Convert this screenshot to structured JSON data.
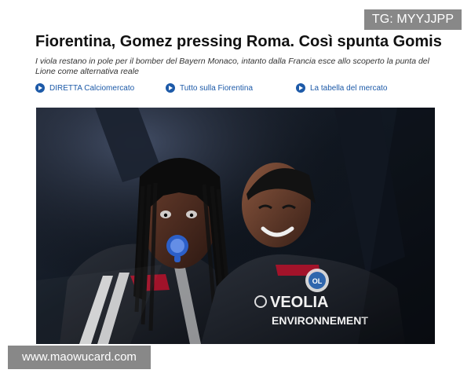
{
  "watermarks": {
    "top_tag": "TG: MYYJJPP",
    "bottom_site": "www.maowucard.com"
  },
  "article": {
    "headline": "Fiorentina, Gomez pressing Roma. Così spunta Gomis",
    "subheadline": "I viola restano in pole per il bomber del Bayern Monaco, intanto dalla Francia esce allo scoperto la punta del Lione come alternativa reale"
  },
  "links": [
    {
      "label": "DIRETTA Calciomercato",
      "icon": "play-circle-icon"
    },
    {
      "label": "Tutto sulla Fiorentina",
      "icon": "play-circle-icon"
    },
    {
      "label": "La tabella del mercato",
      "icon": "play-circle-icon"
    }
  ],
  "photo": {
    "sponsor_line_1": "VEOLIA",
    "sponsor_line_2": "ENVIRONNEMENT",
    "badge_text": "OL"
  },
  "colors": {
    "link": "#1d5aa8",
    "text": "#111111",
    "watermark": "#7a7a7a"
  }
}
